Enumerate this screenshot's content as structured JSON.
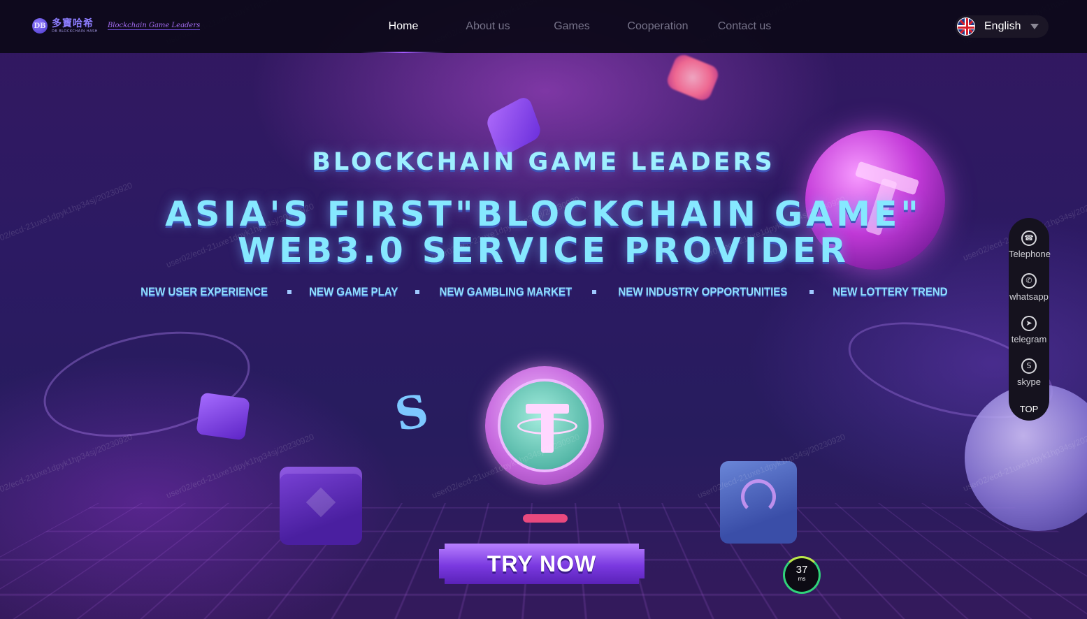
{
  "brand": {
    "mark": "DB",
    "name_cn": "多寶哈希",
    "name_en": "DB BLOCKCHAIN HASH",
    "slogan": "Blockchain Game Leaders"
  },
  "nav": {
    "items": [
      {
        "label": "Home",
        "active": true
      },
      {
        "label": "About us",
        "active": false
      },
      {
        "label": "Games",
        "active": false
      },
      {
        "label": "Cooperation",
        "active": false
      },
      {
        "label": "Contact us",
        "active": false
      }
    ]
  },
  "language": {
    "selected": "English",
    "flag_icon": "uk-flag-icon",
    "dropdown_icon": "caret-down-icon"
  },
  "hero": {
    "kicker": "BLOCKCHAIN GAME LEADERS",
    "title_line1": "ASIA'S FIRST\"BLOCKCHAIN GAME\"",
    "title_line2": "WEB3.0 SERVICE PROVIDER",
    "taglines": [
      "NEW USER EXPERIENCE",
      "NEW GAME PLAY",
      "NEW GAMBLING MARKET",
      "NEW INDUSTRY OPPORTUNITIES",
      "NEW LOTTERY TREND"
    ],
    "cta_label": "TRY NOW"
  },
  "contact_rail": {
    "items": [
      {
        "label": "Telephone",
        "icon": "phone-icon"
      },
      {
        "label": "whatsapp",
        "icon": "whatsapp-icon"
      },
      {
        "label": "telegram",
        "icon": "telegram-icon"
      },
      {
        "label": "skype",
        "icon": "skype-icon"
      }
    ],
    "top_label": "TOP"
  },
  "latency": {
    "value": "37",
    "unit": "ms"
  },
  "watermark": {
    "text": "user02/ecd-21uxe1dpyk1hp34sj/20230920"
  },
  "colors": {
    "accent": "#a45cff",
    "headline": "#86e8ff",
    "nav_bg": "#0c0818",
    "rail_bg": "#15121e"
  }
}
